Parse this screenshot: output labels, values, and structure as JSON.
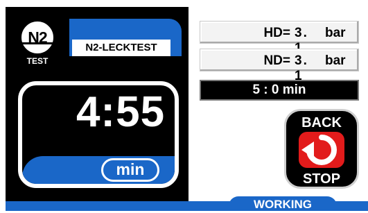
{
  "header": {
    "logo_text": "N2",
    "logo_sub": "TEST",
    "title": "N2-LECKTEST"
  },
  "timer": {
    "value": "4:55",
    "unit": "min"
  },
  "readings": [
    {
      "label": "HD=",
      "value": "3. 1",
      "unit": "bar"
    },
    {
      "label": "ND=",
      "value": "3. 1",
      "unit": "bar"
    }
  ],
  "duration": "5 :   0 min",
  "button": {
    "top_label": "BACK",
    "bottom_label": "STOP"
  },
  "status": "WORKING",
  "colors": {
    "accent_blue": "#1a67c8",
    "stop_red": "#e21b1b",
    "panel_black": "#000000"
  }
}
